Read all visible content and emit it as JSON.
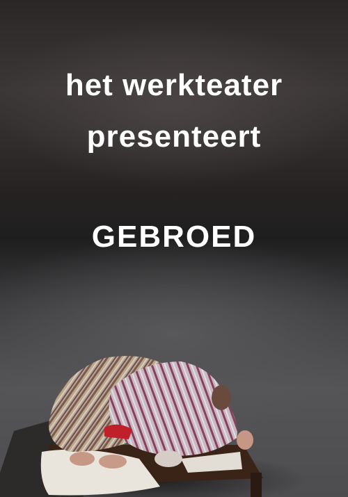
{
  "poster": {
    "line1": "het werkteater",
    "line2": "presenteert",
    "title": "GEBROED"
  },
  "colors": {
    "text": "#ffffff",
    "background_dark": "#1f1e1f",
    "floor": "#555557",
    "table": "#3a2418",
    "accent_red": "#c0202a"
  }
}
